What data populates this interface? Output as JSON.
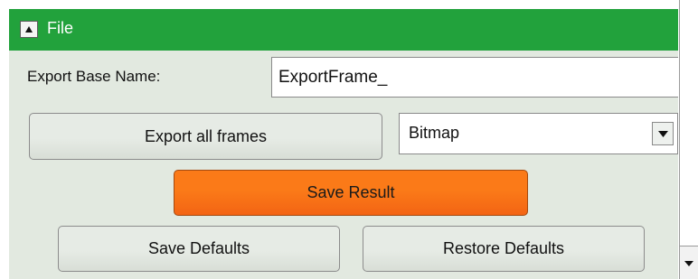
{
  "section": {
    "title": "File",
    "collapse_icon": "triangle-up-icon"
  },
  "export_base_name": {
    "label": "Export Base Name:",
    "value": "ExportFrame_"
  },
  "export_all_frames": {
    "label": "Export all frames"
  },
  "format_select": {
    "selected": "Bitmap",
    "arrow_icon": "triangle-down-icon"
  },
  "save_result": {
    "label": "Save Result",
    "color": "#fb7a18"
  },
  "save_defaults": {
    "label": "Save Defaults"
  },
  "restore_defaults": {
    "label": "Restore Defaults"
  },
  "colors": {
    "header": "#22a23c",
    "panel_background": "#e2e9e0"
  }
}
